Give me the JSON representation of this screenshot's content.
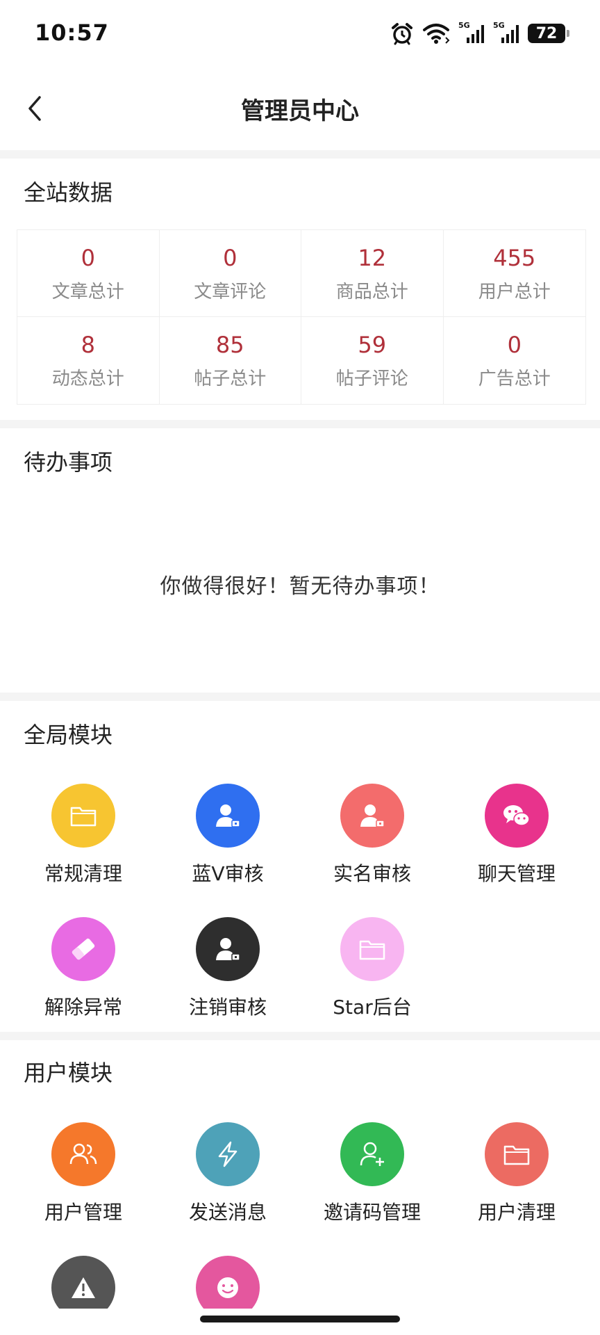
{
  "status_bar": {
    "time": "10:57",
    "signal1_label": "5G",
    "signal2_label": "5G",
    "battery": "72"
  },
  "nav": {
    "title": "管理员中心"
  },
  "site_data": {
    "title": "全站数据",
    "stats": [
      {
        "value": "0",
        "label": "文章总计"
      },
      {
        "value": "0",
        "label": "文章评论"
      },
      {
        "value": "12",
        "label": "商品总计"
      },
      {
        "value": "455",
        "label": "用户总计"
      },
      {
        "value": "8",
        "label": "动态总计"
      },
      {
        "value": "85",
        "label": "帖子总计"
      },
      {
        "value": "59",
        "label": "帖子评论"
      },
      {
        "value": "0",
        "label": "广告总计"
      }
    ]
  },
  "todo": {
    "title": "待办事项",
    "empty_text": "你做得很好！暂无待办事项！"
  },
  "global_modules": {
    "title": "全局模块",
    "items": [
      {
        "label": "常规清理",
        "icon": "folder-icon",
        "color": "#f7c531"
      },
      {
        "label": "蓝V审核",
        "icon": "user-lock-icon",
        "color": "#2f6ff0"
      },
      {
        "label": "实名审核",
        "icon": "user-lock-icon",
        "color": "#f36c6c"
      },
      {
        "label": "聊天管理",
        "icon": "wechat-icon",
        "color": "#e8338c"
      },
      {
        "label": "解除异常",
        "icon": "eraser-icon",
        "color": "#e86be3"
      },
      {
        "label": "注销审核",
        "icon": "user-lock-icon",
        "color": "#2e2e2e"
      },
      {
        "label": "Star后台",
        "icon": "folder-icon",
        "color": "#f8b5f1"
      }
    ]
  },
  "user_modules": {
    "title": "用户模块",
    "items": [
      {
        "label": "用户管理",
        "icon": "users-icon",
        "color": "#f5782b"
      },
      {
        "label": "发送消息",
        "icon": "lightning-icon",
        "color": "#4ea2b8"
      },
      {
        "label": "邀请码管理",
        "icon": "user-add-icon",
        "color": "#32b955"
      },
      {
        "label": "用户清理",
        "icon": "folder-icon",
        "color": "#ec6b62"
      },
      {
        "label": "",
        "icon": "warning-icon",
        "color": "#555555"
      },
      {
        "label": "",
        "icon": "smile-icon",
        "color": "#e4579e"
      }
    ]
  }
}
